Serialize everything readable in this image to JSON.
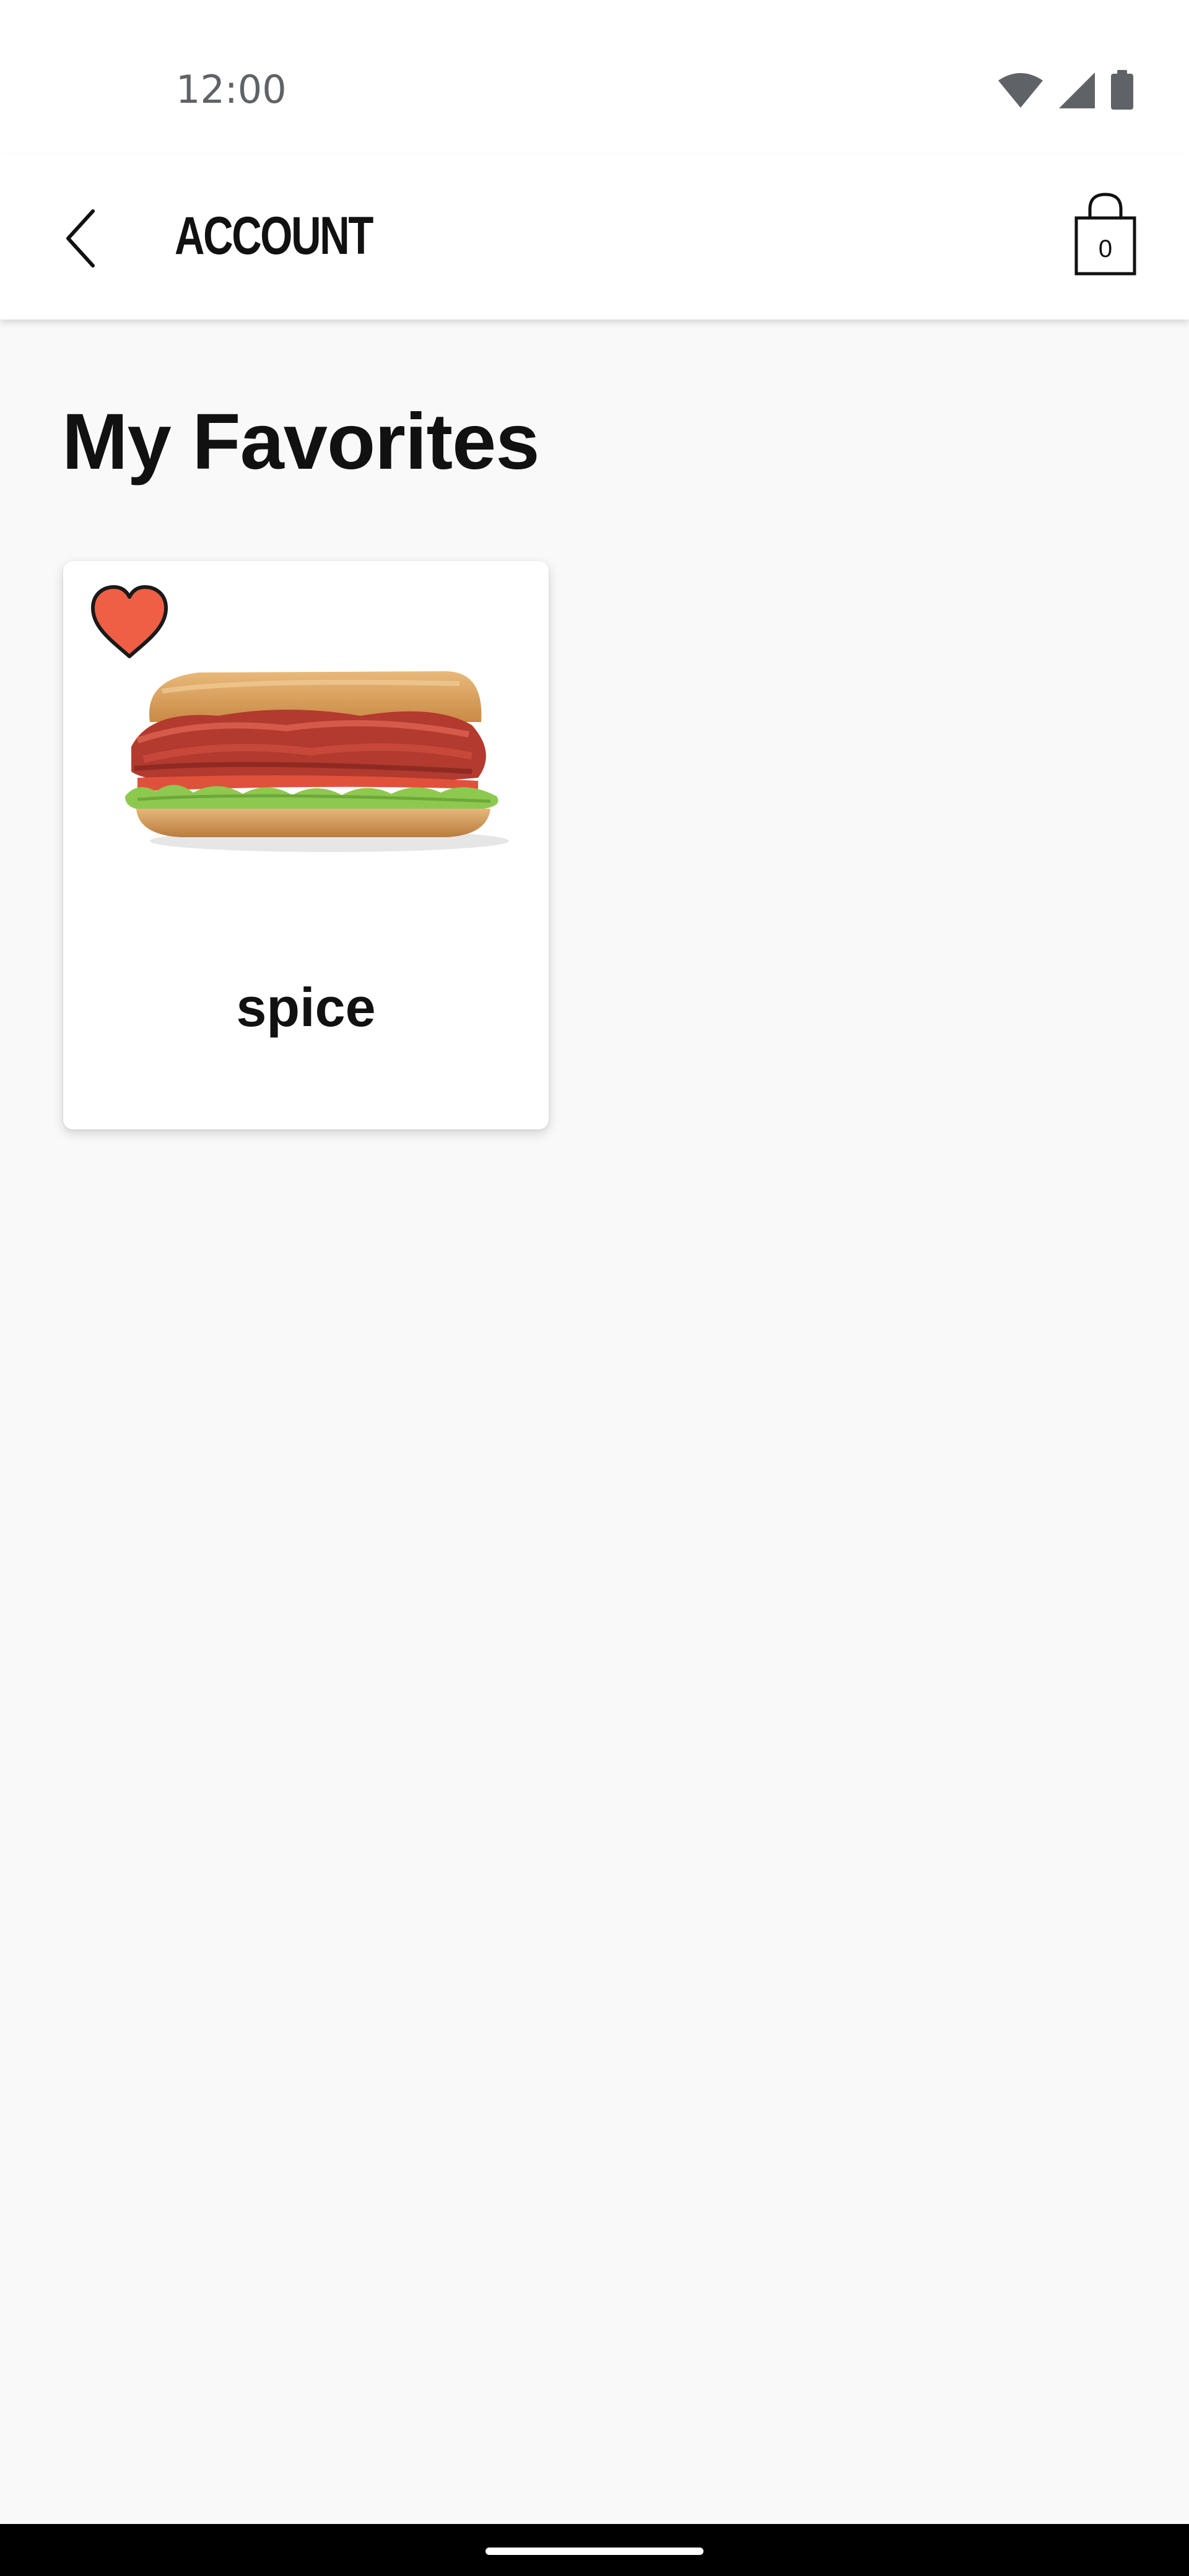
{
  "status_bar": {
    "time": "12:00",
    "icons": [
      "wifi-icon",
      "cellular-signal-icon",
      "battery-icon"
    ]
  },
  "app_bar": {
    "back_icon": "chevron-left-icon",
    "title": "ACCOUNT",
    "bag_icon": "shopping-bag-icon",
    "bag_count": "0"
  },
  "main": {
    "section_title": "My Favorites",
    "favorites": [
      {
        "name": "spice",
        "favorited": true,
        "heart_color": "#ef5f45",
        "image": "sandwich-image"
      }
    ]
  },
  "colors": {
    "background": "#f9f9f9",
    "surface": "#ffffff",
    "text": "#111111",
    "heart": "#ef5f45"
  }
}
